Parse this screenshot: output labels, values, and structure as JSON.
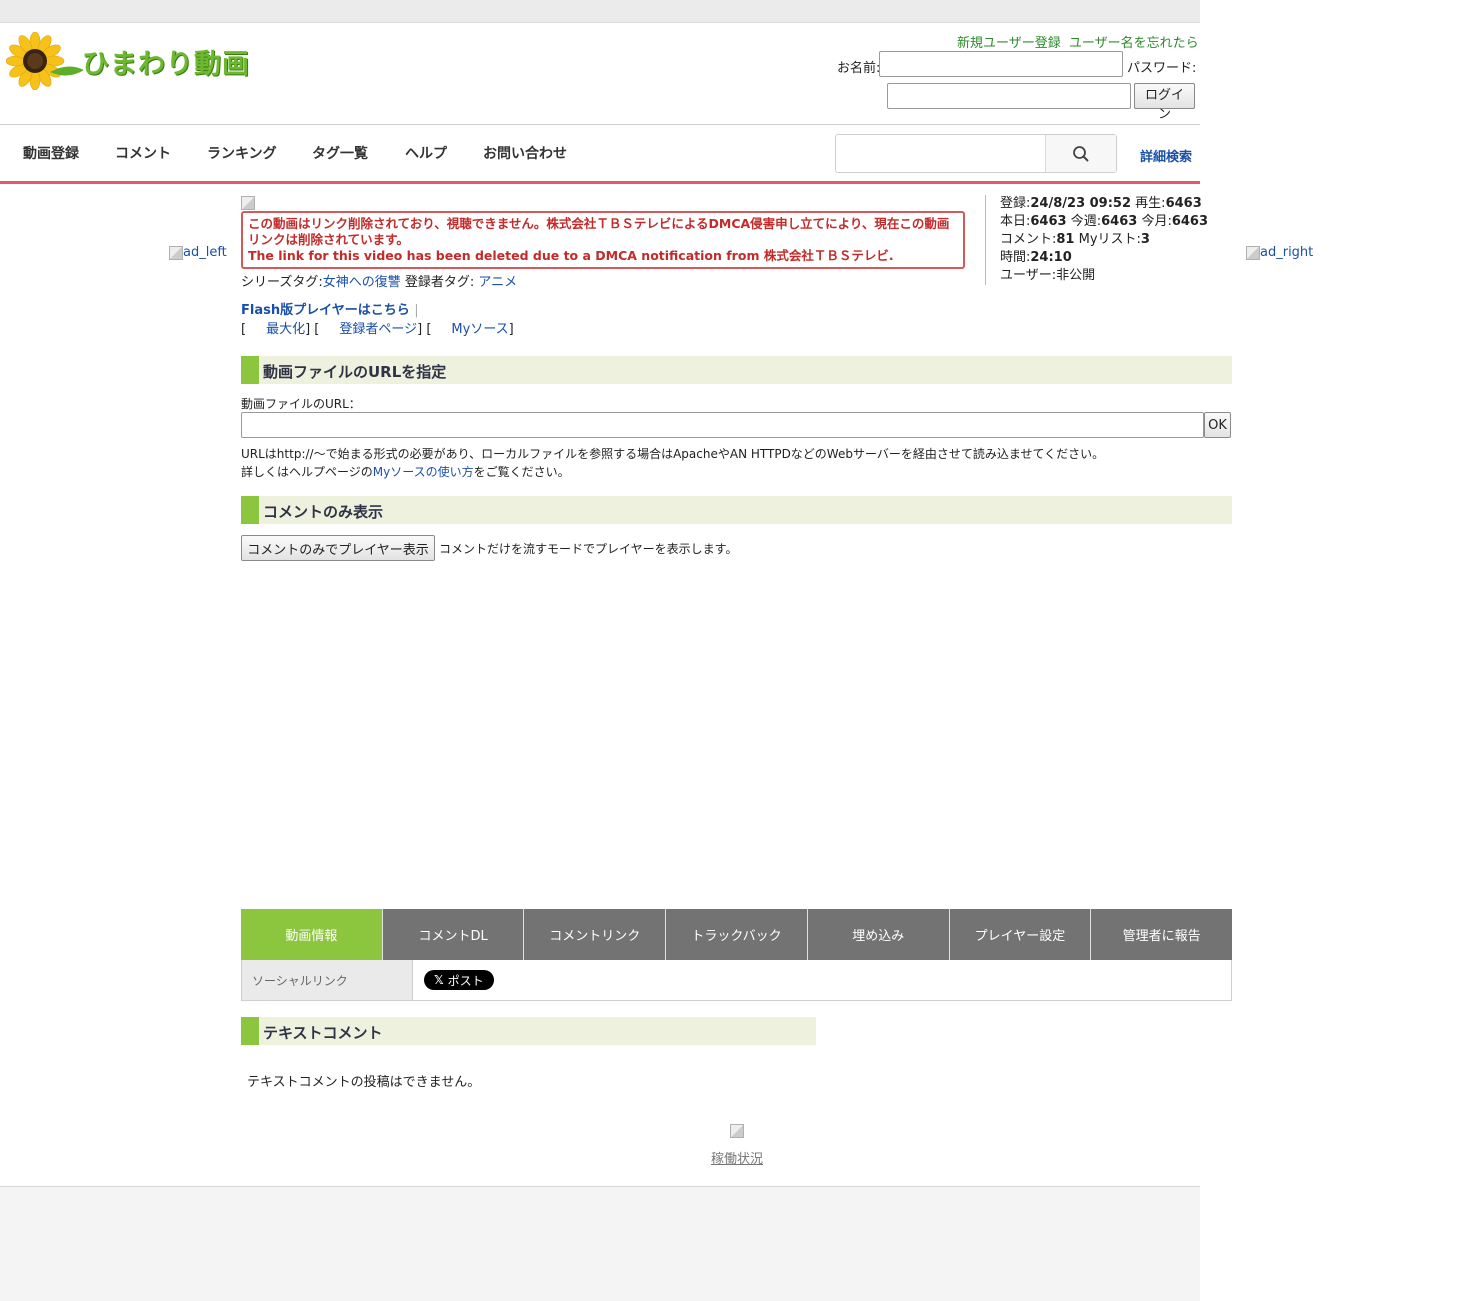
{
  "logo": {
    "text": "ひまわり動画"
  },
  "header": {
    "register_link": "新規ユーザー登録",
    "forgot_link": "ユーザー名を忘れたら",
    "name_label": "お名前:",
    "password_label": "パスワード:",
    "login_button": "ログイン"
  },
  "nav": {
    "items": [
      "動画登録",
      "コメント",
      "ランキング",
      "タグ一覧",
      "ヘルプ",
      "お問い合わせ"
    ],
    "advanced_search": "詳細検索"
  },
  "ads": {
    "left": "ad_left",
    "right": "ad_right"
  },
  "notice": {
    "jp": "この動画はリンク削除されており、視聴できません。株式会社ＴＢＳテレビによるDMCA侵害申し立てにより、現在この動画リンクは削除されています。",
    "en": "The link for this video has been deleted due to a DMCA notification from 株式会社ＴＢＳテレビ."
  },
  "tags": {
    "series_label": "シリーズタグ:",
    "series_value": "女神への復讐",
    "user_label": "登録者タグ:",
    "user_value": "アニメ"
  },
  "links": {
    "flash_player": "Flash版プレイヤーはこちら",
    "separator": "|",
    "maximize": "最大化",
    "uploader_page": "登録者ページ",
    "my_source": "Myソース"
  },
  "stats": {
    "registered_label": "登録:",
    "registered_value": "24/8/23 09:52",
    "plays_label": "再生:",
    "plays_value": "6463",
    "today_label": "本日:",
    "today_value": "6463",
    "week_label": "今週:",
    "week_value": "6463",
    "month_label": "今月:",
    "month_value": "6463",
    "comments_label": "コメント:",
    "comments_value": "81",
    "mylist_label": "Myリスト:",
    "mylist_value": "3",
    "duration_label": "時間:",
    "duration_value": "24:10",
    "user_label": "ユーザー:",
    "user_value": "非公開"
  },
  "url_section": {
    "title": "動画ファイルのURLを指定",
    "field_label": "動画ファイルのURL：",
    "ok_button": "OK",
    "help_line1": "URLはhttp://〜で始まる形式の必要があり、ローカルファイルを参照する場合はApacheやAN HTTPDなどのWebサーバーを経由させて読み込ませてください。",
    "help_line2_prefix": "詳しくはヘルプページの",
    "help_line2_link": "Myソースの使い方",
    "help_line2_suffix": "をご覧ください。"
  },
  "comment_only": {
    "title": "コメントのみ表示",
    "button": "コメントのみでプレイヤー表示",
    "description": "コメントだけを流すモードでプレイヤーを表示します。"
  },
  "tabs": [
    "動画情報",
    "コメントDL",
    "コメントリンク",
    "トラックバック",
    "埋め込み",
    "プレイヤー設定",
    "管理者に報告"
  ],
  "social": {
    "label": "ソーシャルリンク",
    "post_button": "ポスト"
  },
  "text_comment": {
    "title": "テキストコメント",
    "message": "テキストコメントの投稿はできません。"
  },
  "footer": {
    "status_link": "稼働状況"
  },
  "colors": {
    "accent_green": "#8cc63f",
    "nav_red": "#e35a6a",
    "tab_gray": "#737373",
    "notice_red": "#c42a2a"
  }
}
